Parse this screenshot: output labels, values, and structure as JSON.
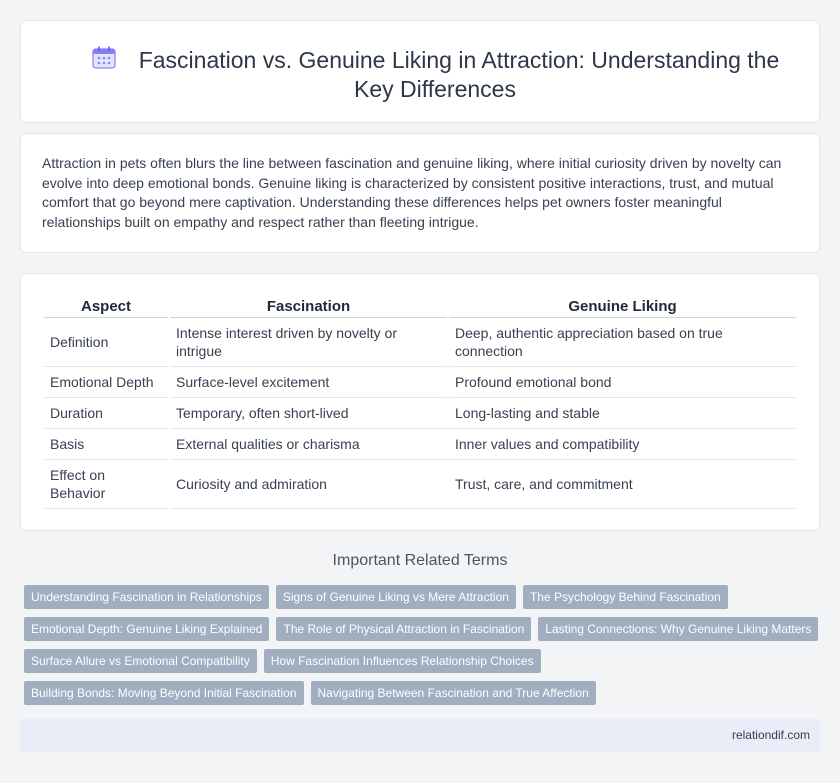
{
  "header": {
    "title": "Fascination vs. Genuine Liking in Attraction: Understanding the Key Differences"
  },
  "intro": {
    "text": "Attraction in pets often blurs the line between fascination and genuine liking, where initial curiosity driven by novelty can evolve into deep emotional bonds. Genuine liking is characterized by consistent positive interactions, trust, and mutual comfort that go beyond mere captivation. Understanding these differences helps pet owners foster meaningful relationships built on empathy and respect rather than fleeting intrigue."
  },
  "table": {
    "headers": [
      "Aspect",
      "Fascination",
      "Genuine Liking"
    ],
    "rows": [
      [
        "Definition",
        "Intense interest driven by novelty or intrigue",
        "Deep, authentic appreciation based on true connection"
      ],
      [
        "Emotional Depth",
        "Surface-level excitement",
        "Profound emotional bond"
      ],
      [
        "Duration",
        "Temporary, often short-lived",
        "Long-lasting and stable"
      ],
      [
        "Basis",
        "External qualities or charisma",
        "Inner values and compatibility"
      ],
      [
        "Effect on Behavior",
        "Curiosity and admiration",
        "Trust, care, and commitment"
      ]
    ]
  },
  "related": {
    "heading": "Important Related Terms",
    "rows": [
      [
        "Understanding Fascination in Relationships",
        "Signs of Genuine Liking vs Mere Attraction",
        "The Psychology Behind Fascination"
      ],
      [
        "Emotional Depth: Genuine Liking Explained",
        "The Role of Physical Attraction in Fascination",
        "Lasting Connections: Why Genuine Liking Matters"
      ],
      [
        "Surface Allure vs Emotional Compatibility",
        "How Fascination Influences Relationship Choices"
      ],
      [
        "Building Bonds: Moving Beyond Initial Fascination",
        "Navigating Between Fascination and True Affection"
      ]
    ]
  },
  "footer": {
    "site": "relationdif.com"
  },
  "colors": {
    "tag_bg": "#a0aec0",
    "footer_bg": "#e8edf7",
    "icon_accent": "#8b7cf6"
  },
  "icons": {
    "title_icon": "calendar-icon"
  }
}
